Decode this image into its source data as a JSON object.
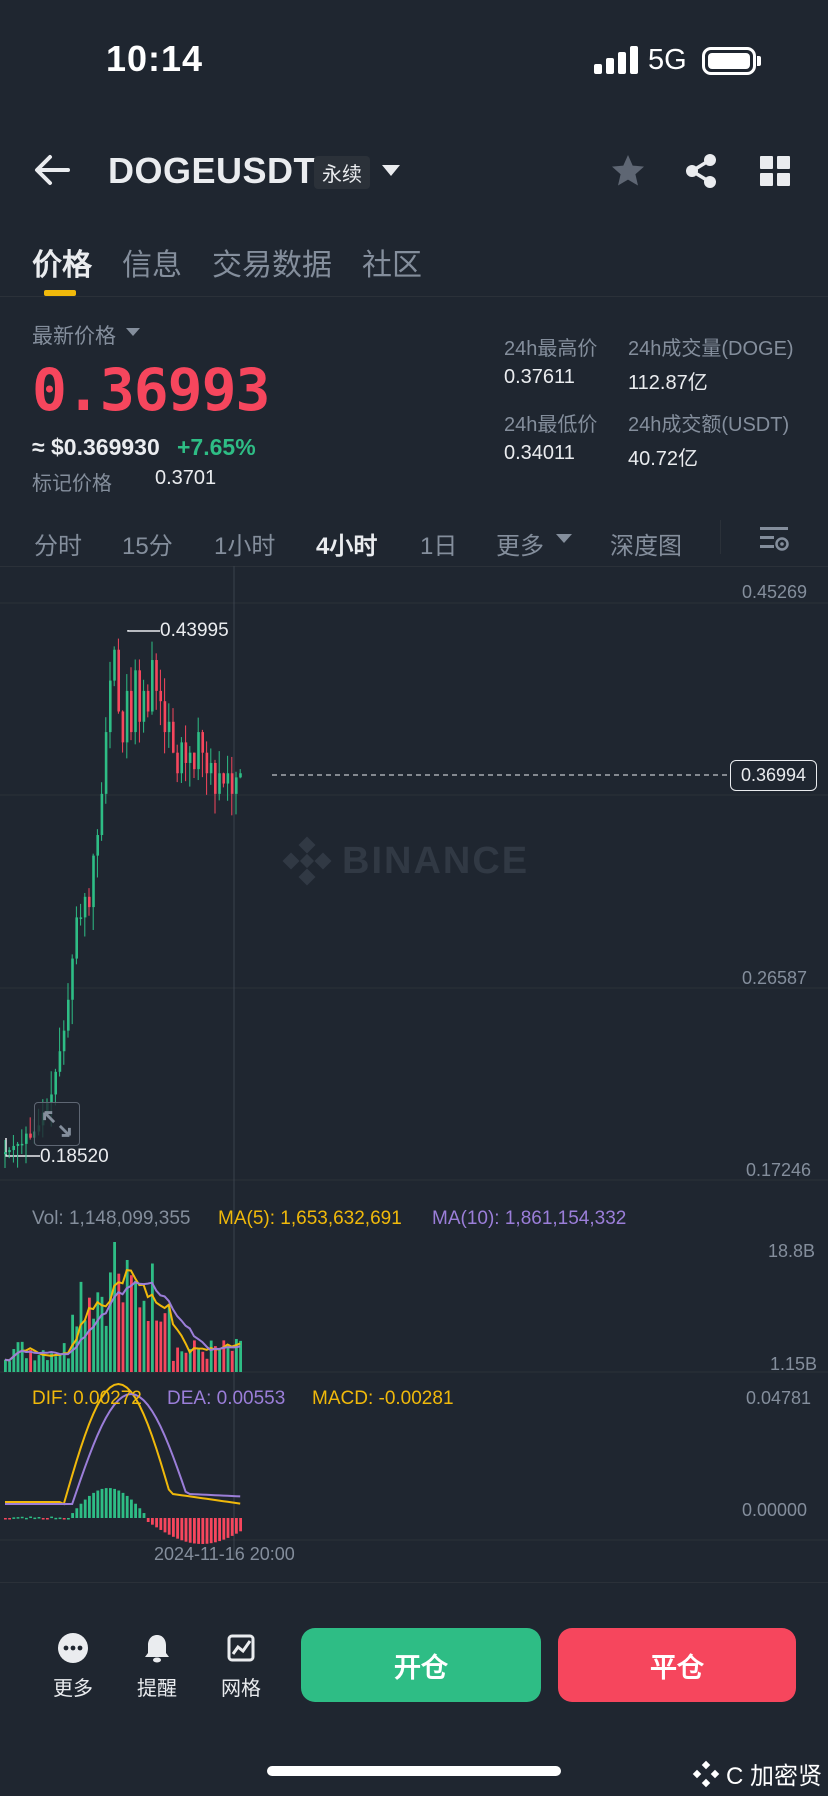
{
  "status_bar": {
    "time": "10:14",
    "network": "5G"
  },
  "header": {
    "symbol": "DOGEUSDT",
    "contract_tag": "永续"
  },
  "tabs": [
    {
      "label": "价格",
      "active": true
    },
    {
      "label": "信息",
      "active": false
    },
    {
      "label": "交易数据",
      "active": false
    },
    {
      "label": "社区",
      "active": false
    }
  ],
  "price": {
    "latest_label": "最新价格",
    "last": "0.36993",
    "usd": "≈ $0.369930",
    "change_pct": "+7.65%",
    "mark_label": "标记价格",
    "mark_value": "0.3701"
  },
  "stats": {
    "high_label": "24h最高价",
    "high": "0.37611",
    "vol_base_label": "24h成交量(DOGE)",
    "vol_base": "112.87亿",
    "low_label": "24h最低价",
    "low": "0.34011",
    "vol_quote_label": "24h成交额(USDT)",
    "vol_quote": "40.72亿"
  },
  "intervals": [
    {
      "label": "分时",
      "active": false
    },
    {
      "label": "15分",
      "active": false
    },
    {
      "label": "1小时",
      "active": false
    },
    {
      "label": "4小时",
      "active": true
    },
    {
      "label": "1日",
      "active": false
    },
    {
      "label": "更多",
      "active": false
    },
    {
      "label": "深度图",
      "active": false
    }
  ],
  "chart": {
    "price_axis": [
      "0.45269",
      "0.26587",
      "0.17246"
    ],
    "current_price_tag": "0.36994",
    "period_high": "0.43995",
    "period_low": "0.18520",
    "watermark": "BINANCE",
    "volume": {
      "vol_text": "Vol: 1,148,099,355",
      "ma5_text": "MA(5): 1,653,632,691",
      "ma10_text": "MA(10): 1,861,154,332",
      "axis_top": "18.8B",
      "axis_bottom": "1.15B"
    },
    "macd": {
      "dif_text": "DIF: 0.00272",
      "dea_text": "DEA: 0.00553",
      "macd_text": "MACD: -0.00281",
      "axis_top": "0.04781",
      "axis_zero": "0.00000"
    },
    "date_label": "2024-11-16 20:00"
  },
  "colors": {
    "up": "#2ebd85",
    "down": "#f6465d",
    "accent": "#f0b90b",
    "ma5": "#f0b90b",
    "ma10": "#9b7ed9"
  },
  "bottom_bar": {
    "more": "更多",
    "alert": "提醒",
    "grid": "网格",
    "open": "开仓",
    "close": "平仓"
  },
  "corner_watermark": "C 加密贤"
}
